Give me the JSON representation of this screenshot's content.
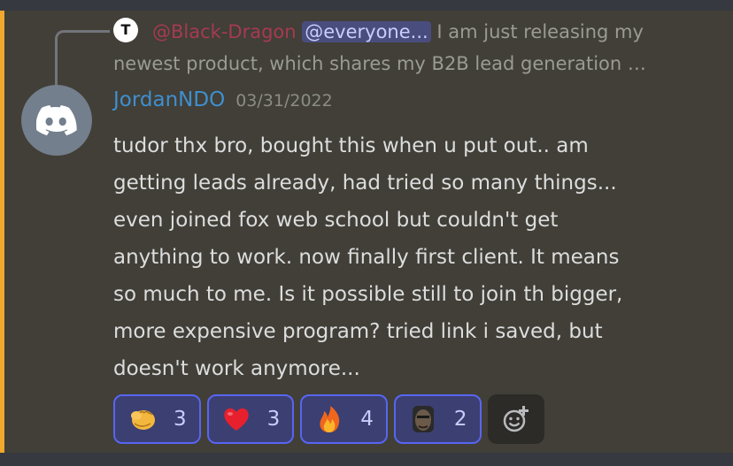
{
  "reply": {
    "avatar_glyph": "T",
    "author": "@Black-Dragon",
    "mention": "@everyone...",
    "preview_line1": " I am just releasing my",
    "preview_line2": "newest product, which shares my B2B lead generation …"
  },
  "message": {
    "username": "JordanNDO",
    "timestamp": "03/31/2022",
    "text": "tudor thx bro, bought this when u put out.. am\ngetting leads already, had tried so many things...\neven joined fox web school but couldn't get\nanything to work. now finally first client. It means\nso much to me. Is it possible still to join th bigger,\nmore expensive program? tried link i saved, but\ndoesn't work anymore...",
    "avatar_icon": "discord-logo-icon"
  },
  "reactions": [
    {
      "icon": "fist-emoji-icon",
      "count": "3"
    },
    {
      "icon": "heart-emoji-icon",
      "count": "3"
    },
    {
      "icon": "fire-emoji-icon",
      "count": "4"
    },
    {
      "icon": "face-custom-emoji-icon",
      "count": "2"
    }
  ],
  "colors": {
    "accent": "#f0a82e",
    "username": "#3f8fd0",
    "reply_author": "#a63a52",
    "reaction_border": "#5865f2",
    "message_bg": "#413f37"
  }
}
